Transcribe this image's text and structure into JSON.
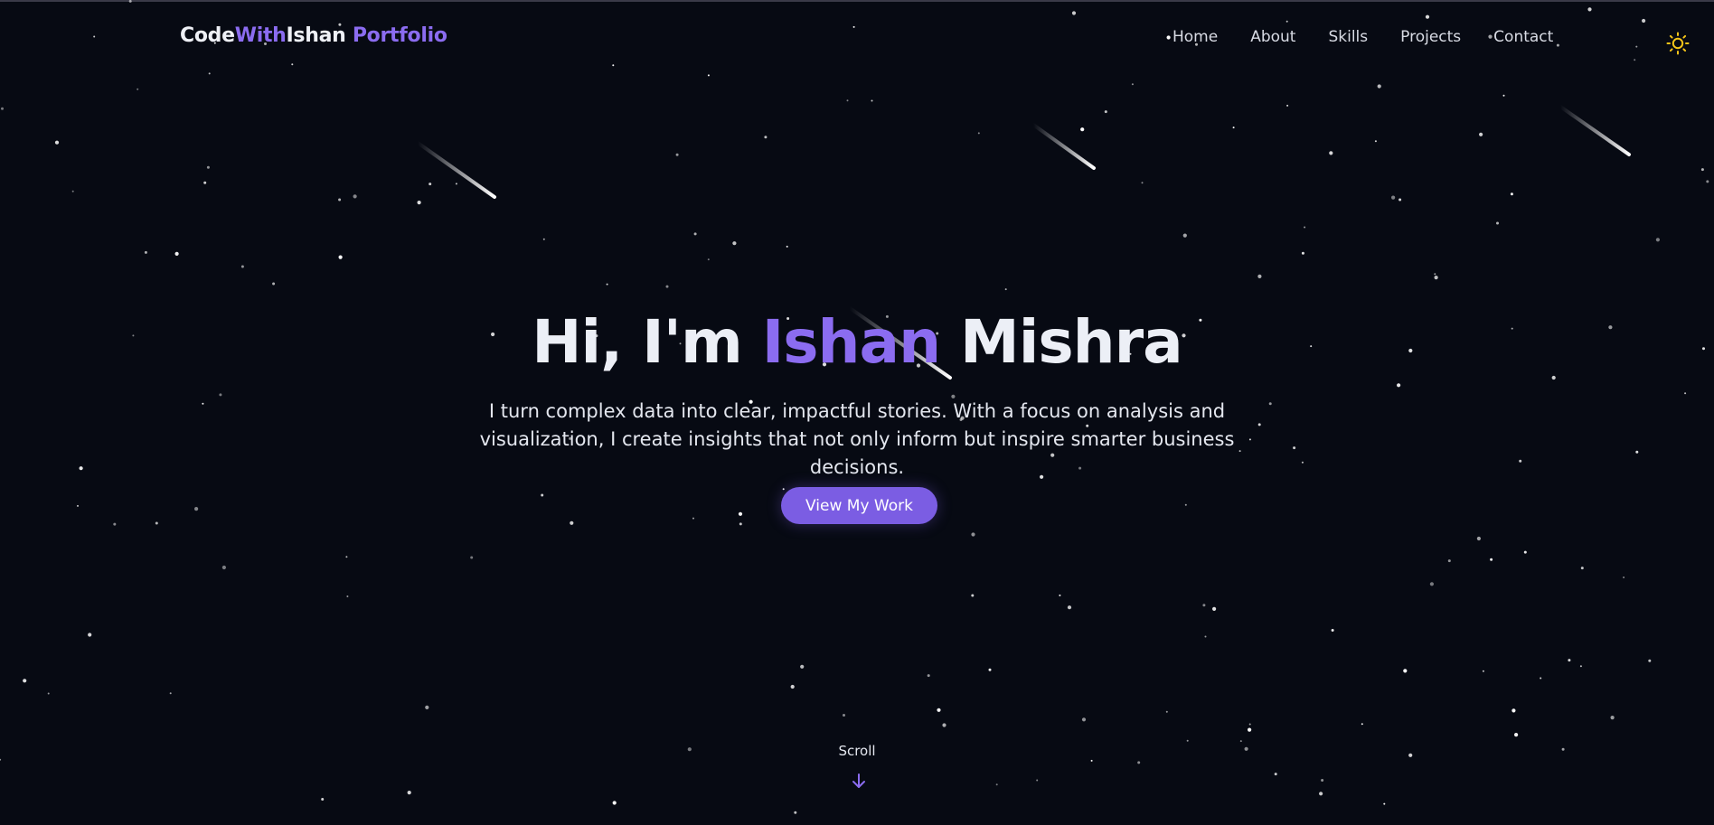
{
  "brand": {
    "part1": "Code",
    "part2": "With",
    "part3": "Ishan",
    "part4": "Portfolio"
  },
  "nav": {
    "items": [
      {
        "label": "Home"
      },
      {
        "label": "About"
      },
      {
        "label": "Skills"
      },
      {
        "label": "Projects"
      },
      {
        "label": "Contact"
      }
    ]
  },
  "theme_toggle": {
    "icon": "sun-icon",
    "color": "#f5c518"
  },
  "hero": {
    "greeting": "Hi, I'm",
    "first_name": "Ishan",
    "last_name": "Mishra",
    "subtitle": "I turn complex data into clear, impactful stories. With a focus on analysis and visualization, I create insights that not only inform but inspire smarter business decisions.",
    "cta_label": "View My Work"
  },
  "scroll": {
    "label": "Scroll",
    "icon": "arrow-down-icon"
  },
  "colors": {
    "accent": "#8b6cf0",
    "button": "#7b5de3",
    "background": "#070a13"
  }
}
